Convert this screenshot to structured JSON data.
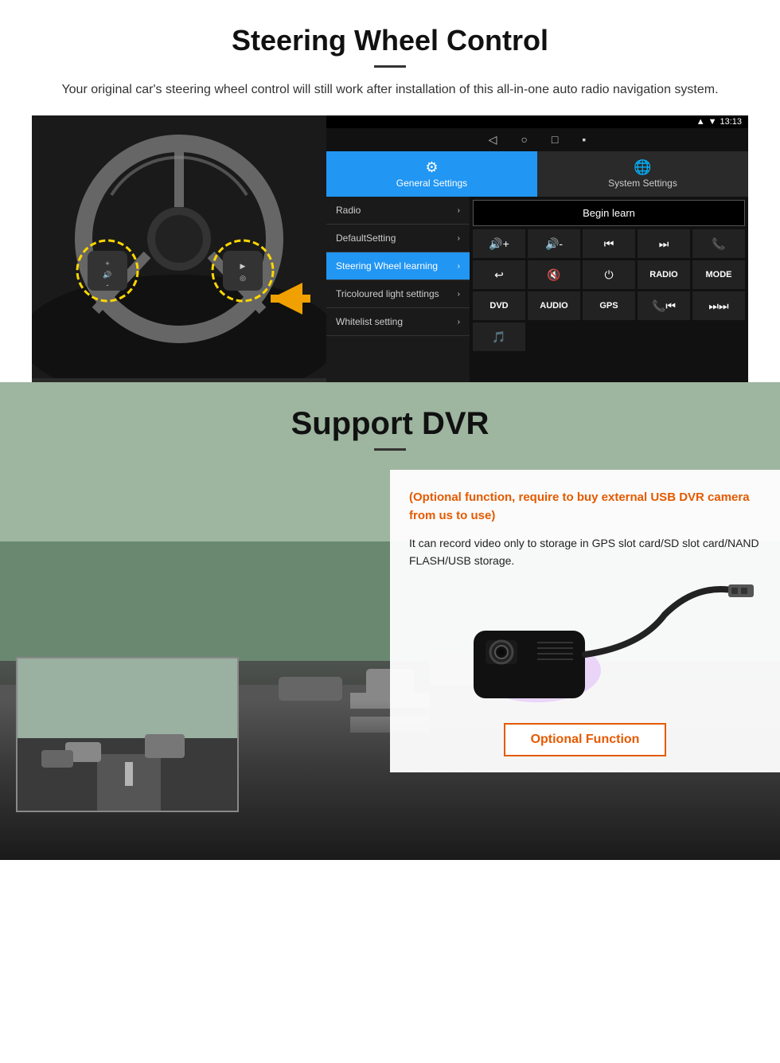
{
  "section1": {
    "heading": "Steering Wheel Control",
    "description": "Your original car's steering wheel control will still work after installation of this all-in-one auto radio navigation system.",
    "statusbar": {
      "time": "13:13",
      "icons": [
        "▲",
        "▼",
        "◼"
      ]
    },
    "tabs": {
      "general": "General Settings",
      "system": "System Settings"
    },
    "menu_items": [
      {
        "label": "Radio",
        "active": false
      },
      {
        "label": "DefaultSetting",
        "active": false
      },
      {
        "label": "Steering Wheel learning",
        "active": true
      },
      {
        "label": "Tricoloured light settings",
        "active": false
      },
      {
        "label": "Whitelist setting",
        "active": false
      }
    ],
    "begin_learn": "Begin learn",
    "control_buttons": [
      "🔊+",
      "🔊-",
      "⏮",
      "⏭",
      "📞",
      "↩",
      "🔇",
      "⏻",
      "RADIO",
      "MODE",
      "DVD",
      "AUDIO",
      "GPS",
      "📞⏮",
      "⏭⏭"
    ]
  },
  "section2": {
    "heading": "Support DVR",
    "orange_title": "(Optional function, require to buy external USB DVR camera from us to use)",
    "description": "It can record video only to storage in GPS slot card/SD slot card/NAND FLASH/USB storage.",
    "optional_button": "Optional Function"
  }
}
